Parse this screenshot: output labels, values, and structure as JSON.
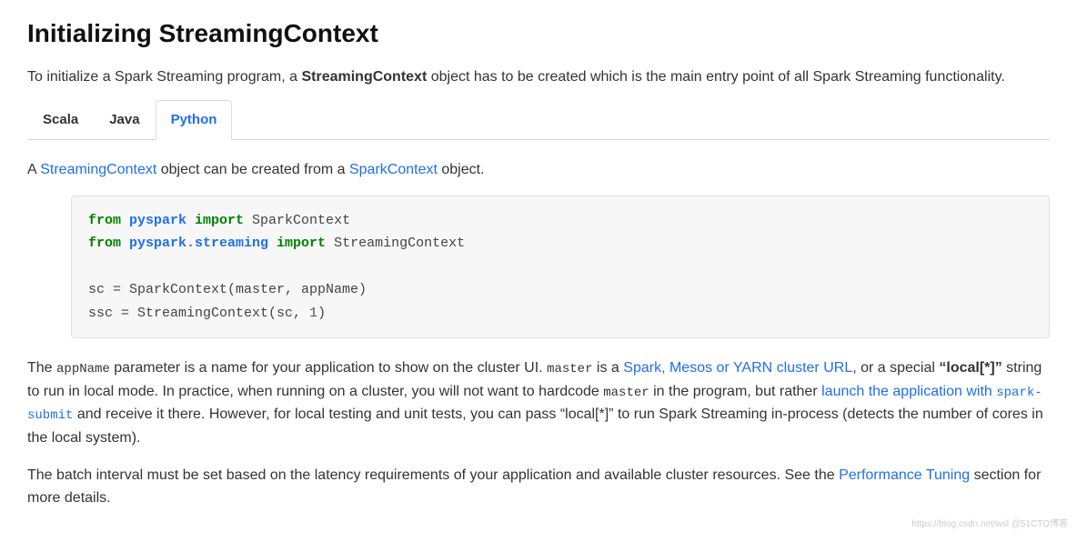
{
  "heading": "Initializing StreamingContext",
  "intro": {
    "pre": "To initialize a Spark Streaming program, a ",
    "strong": "StreamingContext",
    "post": " object has to be created which is the main entry point of all Spark Streaming functionality."
  },
  "tabs": [
    {
      "label": "Scala",
      "active": false
    },
    {
      "label": "Java",
      "active": false
    },
    {
      "label": "Python",
      "active": true
    }
  ],
  "sentence1": {
    "s1": "A ",
    "link1": "StreamingContext",
    "s2": " object can be created from a ",
    "link2": "SparkContext",
    "s3": " object."
  },
  "code": {
    "line1": {
      "kw1": "from",
      "mod1": " pyspark ",
      "kw2": "import",
      "id1": " SparkContext"
    },
    "line2": {
      "kw1": "from",
      "mod1": " pyspark.streaming ",
      "kw2": "import",
      "id1": " StreamingContext"
    },
    "line3": "sc = SparkContext(master, appName)",
    "line4_pre": "ssc = StreamingContext(sc, ",
    "line4_num": "1",
    "line4_post": ")"
  },
  "para2": {
    "s1": "The ",
    "c1": "appName",
    "s2": " parameter is a name for your application to show on the cluster UI. ",
    "c2": "master",
    "s3": " is a ",
    "link1": "Spark, Mesos or YARN cluster URL",
    "s4": ", or a special ",
    "strong1": "“local[*]”",
    "s5": " string to run in local mode. In practice, when running on a cluster, you will not want to hardcode ",
    "c3": "master",
    "s6": " in the program, but rather ",
    "link2_pre": "launch the application with ",
    "link2_code": "spark-submit",
    "s7": " and receive it there. However, for local testing and unit tests, you can pass “local[*]” to run Spark Streaming in-process (detects the number of cores in the local system)."
  },
  "para3": {
    "s1": "The batch interval must be set based on the latency requirements of your application and available cluster resources. See the ",
    "link1": "Performance Tuning",
    "s2": " section for more details."
  },
  "watermark": "https://blog.csdn.net/wsl @51CTO博客"
}
